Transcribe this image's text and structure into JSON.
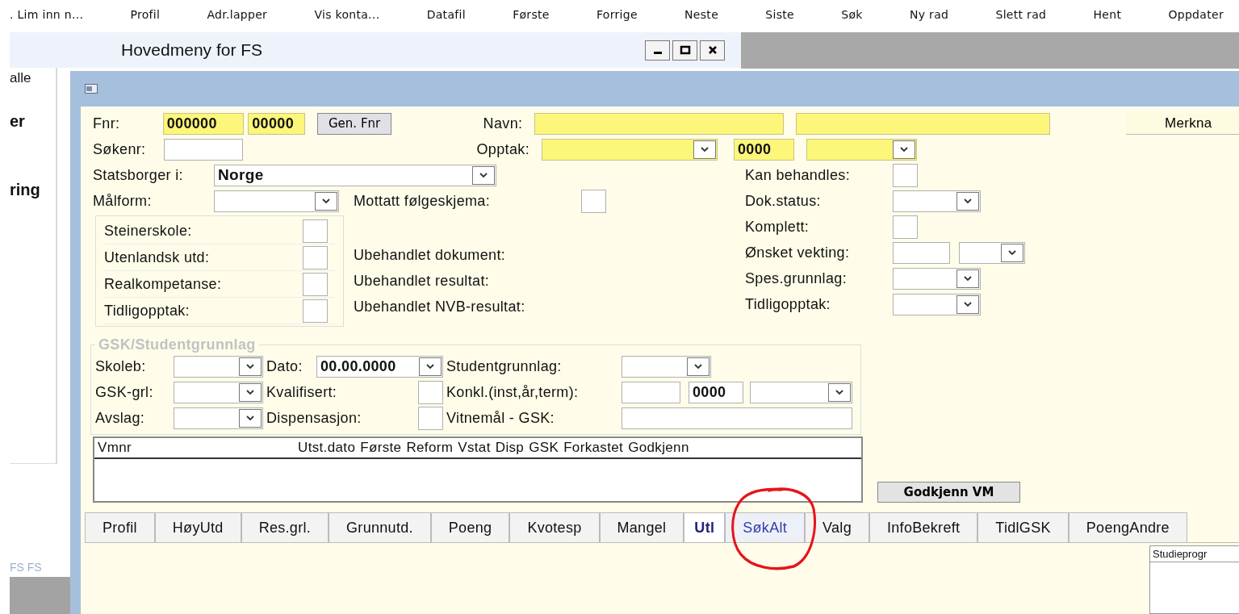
{
  "toolbar": [
    ". Lim inn n...",
    "Profil",
    "Adr.lapper",
    "Vis konta...",
    "Datafil",
    "Første",
    "Forrige",
    "Neste",
    "Siste",
    "Søk",
    "Ny rad",
    "Slett rad",
    "Hent",
    "Oppdater"
  ],
  "main_window": {
    "title": "Hovedmeny for FS",
    "items": [
      {
        "text": "alle",
        "bold": false
      },
      {
        "text": "er",
        "bold": true
      },
      {
        "text": "ring",
        "bold": true
      }
    ],
    "status": "FS FS"
  },
  "form": {
    "fnr": {
      "label": "Fnr:",
      "values": [
        "000000",
        "00000"
      ],
      "required": true,
      "button": "Gen. Fnr"
    },
    "navn": {
      "label": "Navn:",
      "required": true
    },
    "merknad_button": "Merkna",
    "sokenr": {
      "label": "Søkenr:"
    },
    "opptak": {
      "label": "Opptak:",
      "year": "0000",
      "required": true
    },
    "statsborger": {
      "label": "Statsborger i:",
      "value": "Norge"
    },
    "malform": {
      "label": "Målform:"
    },
    "mottatt": {
      "label": "Mottatt følgeskjema:",
      "checked": false
    },
    "checks": [
      {
        "label": "Steinerskole:",
        "checked": false
      },
      {
        "label": "Utenlandsk utd:",
        "checked": false
      },
      {
        "label": "Realkompetanse:",
        "checked": false
      },
      {
        "label": "Tidligopptak:",
        "checked": false
      }
    ],
    "ubehandlet": [
      "Ubehandlet dokument:",
      "Ubehandlet resultat:",
      "Ubehandlet NVB-resultat:"
    ],
    "right": [
      {
        "kind": "check",
        "label": "Kan behandles:",
        "checked": false
      },
      {
        "kind": "combo",
        "label": "Dok.status:"
      },
      {
        "kind": "check",
        "label": "Komplett:",
        "checked": false
      },
      {
        "kind": "text_combo",
        "label": "Ønsket vekting:"
      },
      {
        "kind": "combo",
        "label": "Spes.grunnlag:"
      },
      {
        "kind": "combo",
        "label": "Tidligopptak:"
      }
    ],
    "gsk": {
      "legend": "GSK/Studentgrunnlag",
      "rows": [
        [
          {
            "kind": "combo",
            "label": "Skoleb:"
          },
          {
            "kind": "date",
            "label": "Dato:",
            "value": "00.00.0000"
          },
          {
            "kind": "combo",
            "label": "Studentgrunnlag:"
          }
        ],
        [
          {
            "kind": "combo",
            "label": "GSK-grl:"
          },
          {
            "kind": "check",
            "label": "Kvalifisert:",
            "checked": false
          },
          {
            "kind": "konkl",
            "label": "Konkl.(inst,år,term):",
            "value": "0000"
          }
        ],
        [
          {
            "kind": "combo",
            "label": "Avslag:"
          },
          {
            "kind": "check",
            "label": "Dispensasjon:",
            "checked": false
          },
          {
            "kind": "text",
            "label": "Vitnemål - GSK:"
          }
        ]
      ]
    },
    "list": {
      "columns": [
        "Vmnr",
        "Utst.dato",
        "Første",
        "Reform",
        "Vstat",
        "Disp",
        "GSK",
        "Forkastet",
        "Godkjenn"
      ]
    },
    "godkjenn_button": "Godkjenn VM",
    "tabs": [
      {
        "label": "Profil",
        "selected": false,
        "hovered": false
      },
      {
        "label": "HøyUtd",
        "selected": false,
        "hovered": false
      },
      {
        "label": "Res.grl.",
        "selected": false,
        "hovered": false
      },
      {
        "label": "Grunnutd.",
        "selected": false,
        "hovered": false
      },
      {
        "label": "Poeng",
        "selected": false,
        "hovered": false
      },
      {
        "label": "Kvotesp",
        "selected": false,
        "hovered": false
      },
      {
        "label": "Mangel",
        "selected": false,
        "hovered": false
      },
      {
        "label": "Utl",
        "selected": true,
        "hovered": false
      },
      {
        "label": "SøkAlt",
        "selected": false,
        "hovered": true
      },
      {
        "label": "Valg",
        "selected": false,
        "hovered": false
      },
      {
        "label": "InfoBekreft",
        "selected": false,
        "hovered": false
      },
      {
        "label": "TidlGSK",
        "selected": false,
        "hovered": false
      },
      {
        "label": "PoengAndre",
        "selected": false,
        "hovered": false
      }
    ],
    "side_panel": {
      "header": "Studieprogr"
    }
  }
}
